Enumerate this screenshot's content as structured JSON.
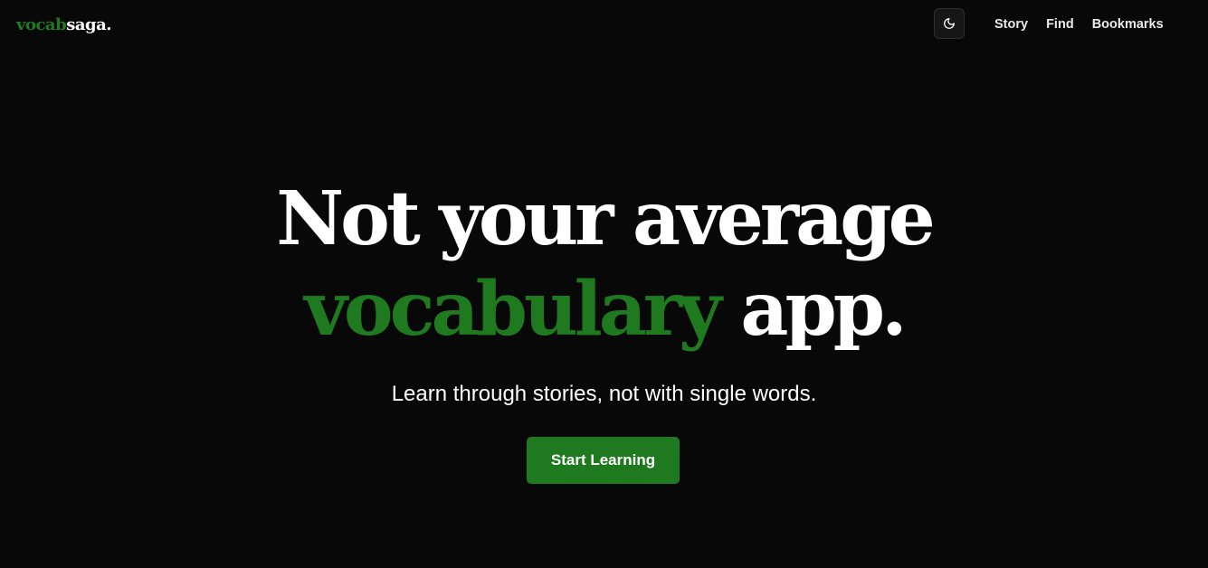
{
  "brand": {
    "part_a": "vocab",
    "part_b": "saga."
  },
  "header": {
    "theme_toggle_icon": "moon-icon",
    "nav": [
      "Story",
      "Find",
      "Bookmarks"
    ]
  },
  "hero": {
    "line1": "Not your average",
    "line2_accent": "vocabulary",
    "line2_rest": "app.",
    "subtitle": "Learn through stories, not with single words.",
    "cta_label": "Start Learning"
  },
  "colors": {
    "background": "#080808",
    "accent": "#1f7a1f",
    "text": "#ffffff"
  }
}
